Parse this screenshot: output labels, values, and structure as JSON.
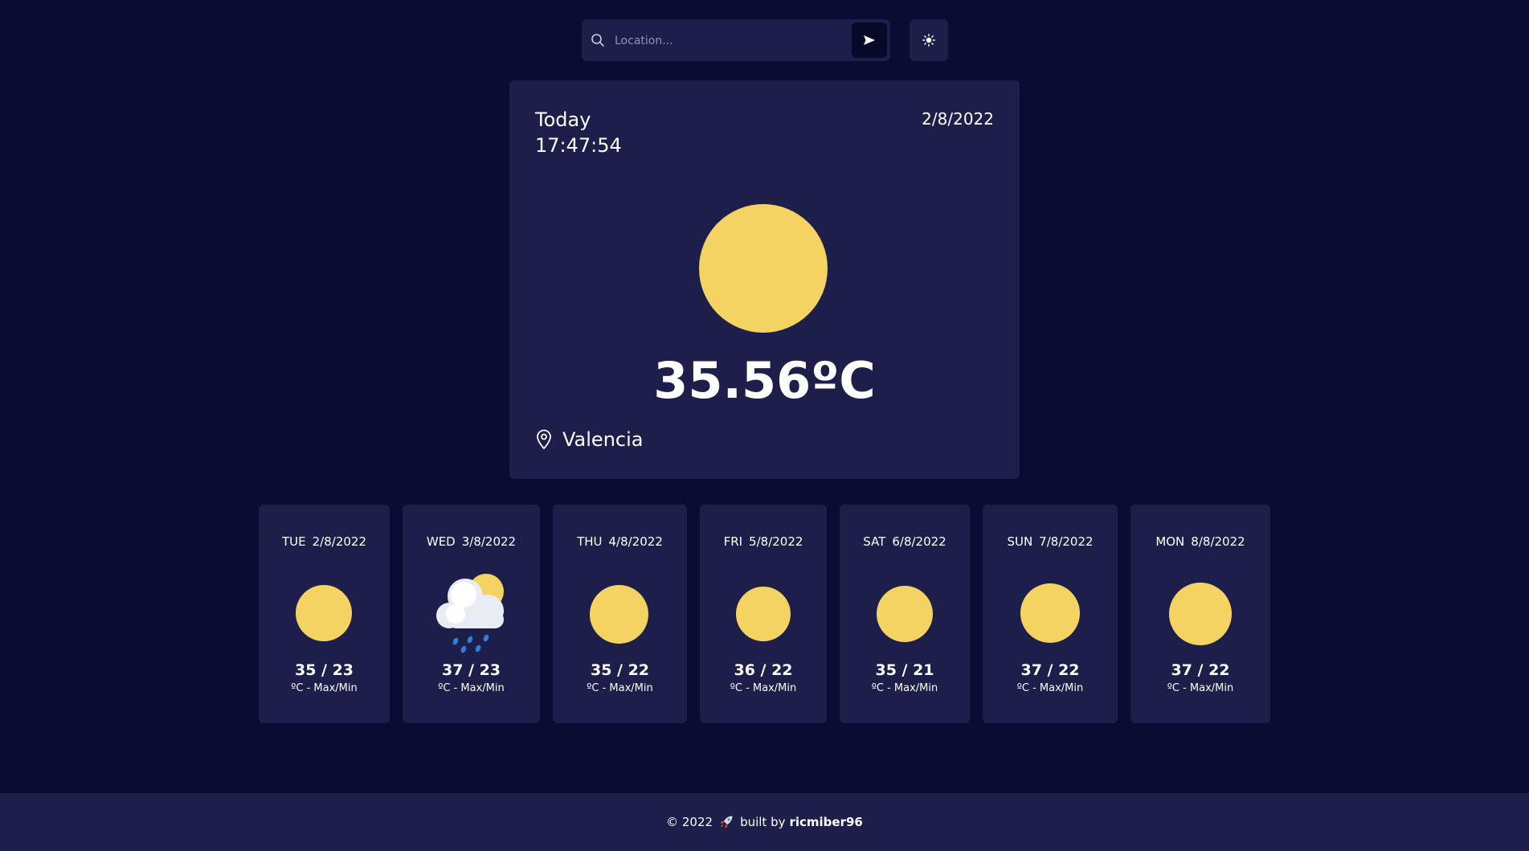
{
  "search": {
    "placeholder": "Location...",
    "value": ""
  },
  "current": {
    "day_label": "Today",
    "time": "17:47:54",
    "date": "2/8/2022",
    "temperature": "35.56ºC",
    "location": "Valencia",
    "icon": "sun-icon"
  },
  "forecast": [
    {
      "day": "TUE",
      "date": "2/8/2022",
      "temps": "35 / 23",
      "unit": "ºC - Max/Min",
      "icon": "sun-icon"
    },
    {
      "day": "WED",
      "date": "3/8/2022",
      "temps": "37 / 23",
      "unit": "ºC - Max/Min",
      "icon": "rain-cloud-sun-icon"
    },
    {
      "day": "THU",
      "date": "4/8/2022",
      "temps": "35 / 22",
      "unit": "ºC - Max/Min",
      "icon": "sun-icon"
    },
    {
      "day": "FRI",
      "date": "5/8/2022",
      "temps": "36 / 22",
      "unit": "ºC - Max/Min",
      "icon": "sun-icon"
    },
    {
      "day": "SAT",
      "date": "6/8/2022",
      "temps": "35 / 21",
      "unit": "ºC - Max/Min",
      "icon": "sun-icon"
    },
    {
      "day": "SUN",
      "date": "7/8/2022",
      "temps": "37 / 22",
      "unit": "ºC - Max/Min",
      "icon": "sun-icon"
    },
    {
      "day": "MON",
      "date": "8/8/2022",
      "temps": "37 / 22",
      "unit": "ºC - Max/Min",
      "icon": "sun-icon"
    }
  ],
  "footer": {
    "copyright": "© 2022",
    "built_by": "built by",
    "author": "ricmiber96"
  },
  "colors": {
    "background": "#0a0c33",
    "card": "#1d1f4a",
    "sun": "#f5d362",
    "text": "#ffffff"
  }
}
